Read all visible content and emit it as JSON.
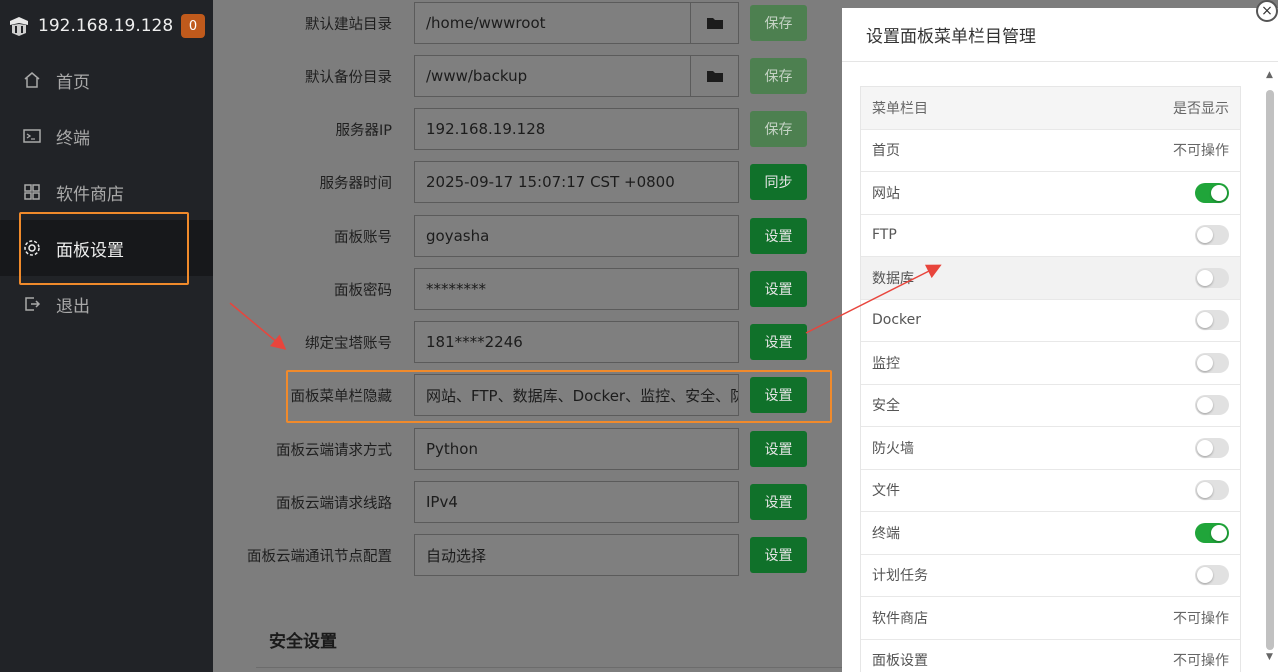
{
  "sidebar": {
    "server_ip": "192.168.19.128",
    "badge_count": "0",
    "items": [
      {
        "label": "首页",
        "icon": "home-icon"
      },
      {
        "label": "终端",
        "icon": "terminal-icon"
      },
      {
        "label": "软件商店",
        "icon": "grid-icon"
      },
      {
        "label": "面板设置",
        "icon": "gear-icon"
      },
      {
        "label": "退出",
        "icon": "logout-icon"
      }
    ],
    "active_index": 3
  },
  "settings": {
    "rows": [
      {
        "label": "默认建站目录",
        "value": "/home/wwwroot",
        "button": "保存",
        "has_folder": true,
        "disabled": true
      },
      {
        "label": "默认备份目录",
        "value": "/www/backup",
        "button": "保存",
        "has_folder": true,
        "disabled": true
      },
      {
        "label": "服务器IP",
        "value": "192.168.19.128",
        "button": "保存",
        "disabled": true
      },
      {
        "label": "服务器时间",
        "value": "2025-09-17 15:07:17 CST +0800",
        "button": "同步"
      },
      {
        "label": "面板账号",
        "value": "goyasha",
        "button": "设置"
      },
      {
        "label": "面板密码",
        "value": "********",
        "button": "设置"
      },
      {
        "label": "绑定宝塔账号",
        "value": "181****2246",
        "button": "设置"
      },
      {
        "label": "面板菜单栏隐藏",
        "value": "网站、FTP、数据库、Docker、监控、安全、防",
        "button": "设置"
      },
      {
        "label": "面板云端请求方式",
        "value": "Python",
        "button": "设置"
      },
      {
        "label": "面板云端请求线路",
        "value": "IPv4",
        "button": "设置"
      },
      {
        "label": "面板云端通讯节点配置",
        "value": "自动选择",
        "button": "设置"
      }
    ],
    "section_title": "安全设置"
  },
  "panel": {
    "title": "设置面板菜单栏目管理",
    "close_label": "×",
    "columns": [
      "菜单栏目",
      "是否显示"
    ],
    "rows": [
      {
        "name": "首页",
        "state": "不可操作"
      },
      {
        "name": "网站",
        "state": "on"
      },
      {
        "name": "FTP",
        "state": "off"
      },
      {
        "name": "数据库",
        "state": "off"
      },
      {
        "name": "Docker",
        "state": "off"
      },
      {
        "name": "监控",
        "state": "off"
      },
      {
        "name": "安全",
        "state": "off"
      },
      {
        "name": "防火墙",
        "state": "off"
      },
      {
        "name": "文件",
        "state": "off"
      },
      {
        "name": "终端",
        "state": "on"
      },
      {
        "name": "计划任务",
        "state": "off"
      },
      {
        "name": "软件商店",
        "state": "不可操作"
      },
      {
        "name": "面板设置",
        "state": "不可操作"
      }
    ]
  },
  "colors": {
    "accent_green": "#20a53a",
    "highlight_orange": "#f08a2b",
    "arrow_red": "#e8453c",
    "badge_orange": "#c05a1c"
  }
}
